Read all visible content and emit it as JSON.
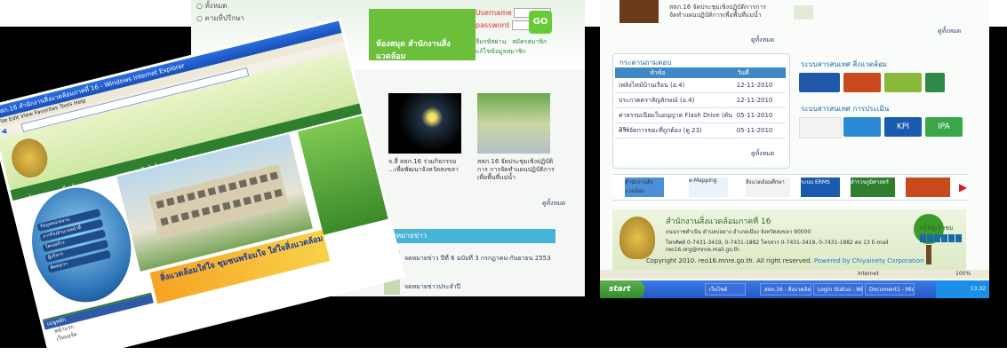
{
  "panel1": {
    "radio_items": [
      "ทั้งหมด",
      "ตามที่ปรึกษา"
    ],
    "login": {
      "username_label": "Username",
      "password_label": "password",
      "go_label": "GO",
      "links": [
        "ลืมรหัสผ่าน",
        "สมัครสมาชิก",
        "แก้ไขข้อมูลสมาชิก"
      ]
    },
    "banner_text": "ห้องสมุด สำนักงานสิ่งแวดล้อม",
    "photos": [
      {
        "caption": "จ.สี่ สสภ.16 ร่วมกิจกรรม ...เพื่อพัฒนาจังหวัดสงขลา"
      },
      {
        "caption": "สสภ.16 จัดประชุมเชิงปฏิบัติการ การจัดทำแผนปฏิบัติการเพื่อพื้นที่แม่น้ำ"
      }
    ],
    "more": "ดูทั้งหมด",
    "news_header": "จดหมายข่าว",
    "news": [
      "จดหมายข่าว ปีที่ 6 ฉบับที่ 3 กรกฎาคม-กันยายน 2553",
      "จดหมายข่าวประจำปี"
    ]
  },
  "panel2": {
    "top_text": "สสภ.16 จัดประชุมเชิงปฏิบัติการการจัดทำแผนปฏิบัติการเพื่อพื้นที่แม่น้ำ",
    "more": "ดูทั้งหมด",
    "webboard_title": "กระดานถามตอบ",
    "table_head": [
      "หัวข้อ",
      "วันที่"
    ],
    "table_rows": [
      {
        "title": "เพลิงไหม้บ้านเรือน (อ.4)",
        "date": "12-11-2010"
      },
      {
        "title": "ประกวดตราสัญลักษณ์ (อ.4)",
        "date": "12-11-2010"
      },
      {
        "title": "ค่าธรรมเนียมใบอนุญาต Flash Drive (ดัน 25)",
        "date": "05-11-2010"
      },
      {
        "title": "การจัดการขยะที่ถูกต้อง (ดู 23)",
        "date": "05-11-2010"
      }
    ],
    "table_more": "ดูทั้งหมด",
    "system1_title": "ระบบสารสนเทศ สิ่งแวดล้อม",
    "system2_title": "ระบบสารสนเทศ การประเมิน",
    "kpi": "KPI",
    "ipa": "IPA",
    "strip_logos": [
      "สำนักงานสิ่งแวดล้อม",
      "e-Mapping",
      "สิ่งแวดล้อมศึกษา",
      "ระบบ ERMS",
      "สำรวจภูมิศาสตร์"
    ],
    "footer_title": "สำนักงานสิ่งแวดล้อมภาคที่ 16",
    "footer_address": "ถนนราชดำเนิน ตำบลบ่อยาง อำเภอเมือง จังหวัดสงขลา 90000",
    "footer_phone": "โทรศัพท์ 0-7431-3419, 0-7431-1882 โทรสาร 0-7431-3419, 0-7431-1882 ต่อ 13 E-mail reo16.org@mnre.mail.go.th",
    "copyright": "Copyright 2010. reo16.mnre.go.th. All right reserved.",
    "powered": "Powered by Chiyainety Corporation",
    "visits_label": "สถิติผู้เข้าชม",
    "status_text": "Internet",
    "zoom": "100%",
    "start_label": "start",
    "tasks": [
      "เว็บไซต์",
      "สสภ.16 - สิ่งแวดล้อม...",
      "Login Status - Windo...",
      "Document1 - Microsoft..."
    ],
    "clock": "13:32"
  },
  "panel3": {
    "title": "สสภ.16 สำนักงานสิ่งแวดล้อมภาคที่ 16 - Windows Internet Explorer",
    "menu": "File  Edit  View  Favorites  Tools  Help",
    "nav": [
      "หน้าแรก",
      "เกี่ยวกับหน่วยงาน",
      "ข่าวประชาสัมพันธ์",
      "ติดต่อเรา"
    ],
    "globe_menu": [
      "ข้อมูลหน่วยงาน",
      "ภารกิจ/อำนาจหน้าที่",
      "โครงสร้าง",
      "ผู้บริหาร",
      "ติดต่อเรา"
    ],
    "banner_text": "สิ่งแวดล้อมใส่ใจ ชุมชนพร้อมใจ ใส่ใจสิ่งแวดล้อม",
    "leftbox_header": "เมนูหลัก",
    "leftbox_items": [
      "หน้าแรก",
      "เว็บบอร์ด"
    ]
  }
}
